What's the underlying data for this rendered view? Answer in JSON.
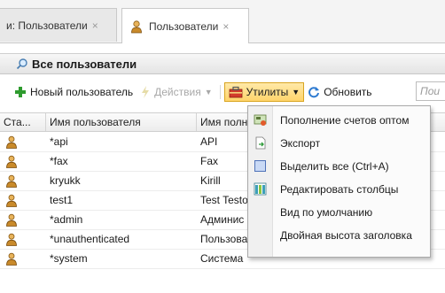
{
  "tabs": [
    {
      "label": "и: Пользователи",
      "close": "×"
    },
    {
      "label": "Пользователи",
      "close": "×"
    }
  ],
  "panel": {
    "title": "Все пользователи"
  },
  "toolbar": {
    "new_user": "Новый пользователь",
    "actions": "Действия",
    "utilities": "Утилиты",
    "refresh": "Обновить",
    "search_placeholder": "Пои"
  },
  "grid": {
    "headers": [
      "Ста...",
      "Имя пользователя",
      "Имя полн"
    ],
    "rows": [
      {
        "username": "*api",
        "fullname": "API"
      },
      {
        "username": "*fax",
        "fullname": "Fax"
      },
      {
        "username": "kryukk",
        "fullname": "Kirill"
      },
      {
        "username": "test1",
        "fullname": "Test Testo"
      },
      {
        "username": "*admin",
        "fullname": "Админис"
      },
      {
        "username": "*unauthenticated",
        "fullname": "Пользователь не зарегистрирован в Print-X"
      },
      {
        "username": "*system",
        "fullname": "Система"
      }
    ]
  },
  "menu": {
    "items": [
      {
        "label": "Пополнение счетов оптом",
        "icon": "bulk-topup-icon"
      },
      {
        "label": "Экспорт",
        "icon": "export-icon"
      },
      {
        "label": "Выделить все (Ctrl+A)",
        "icon": "select-all-icon"
      },
      {
        "label": "Редактировать столбцы",
        "icon": "edit-columns-icon"
      },
      {
        "label": "Вид по умолчанию",
        "icon": ""
      },
      {
        "label": "Двойная высота заголовка",
        "icon": ""
      }
    ]
  },
  "colors": {
    "accent_orange": "#f2b200",
    "user_icon": "#c98a2a",
    "pressed_bg": "#ffd56b"
  }
}
